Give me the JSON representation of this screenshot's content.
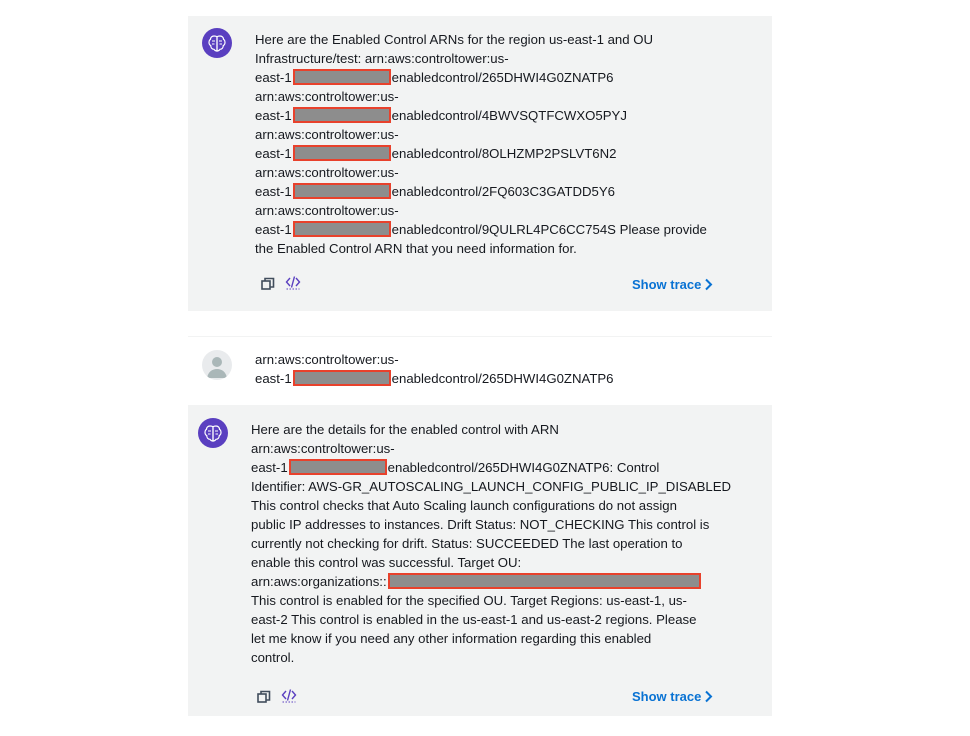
{
  "messages": [
    {
      "role": "assistant",
      "lines": [
        {
          "pre": "Here are the Enabled Control ARNs for the region us-east-1 and OU"
        },
        {
          "pre": "Infrastructure/test: arn:aws:controltower:us-"
        },
        {
          "pre": "east-1",
          "redacted": true,
          "post": "enabledcontrol/265DHWI4G0ZNATP6"
        },
        {
          "pre": "arn:aws:controltower:us-"
        },
        {
          "pre": "east-1",
          "redacted": true,
          "post": "enabledcontrol/4BWVSQTFCWXO5PYJ"
        },
        {
          "pre": "arn:aws:controltower:us-"
        },
        {
          "pre": "east-1",
          "redacted": true,
          "post": "enabledcontrol/8OLHZMP2PSLVT6N2"
        },
        {
          "pre": "arn:aws:controltower:us-"
        },
        {
          "pre": "east-1",
          "redacted": true,
          "post": "enabledcontrol/2FQ603C3GATDD5Y6"
        },
        {
          "pre": "arn:aws:controltower:us-"
        },
        {
          "pre": "east-1",
          "redacted": true,
          "post": "enabledcontrol/9QULRL4PC6CC754S Please provide"
        },
        {
          "pre": "the Enabled Control ARN that you need information for."
        }
      ],
      "show_trace": "Show trace"
    },
    {
      "role": "user",
      "lines": [
        {
          "pre": "arn:aws:controltower:us-"
        },
        {
          "pre": "east-1",
          "redacted": true,
          "post": "enabledcontrol/265DHWI4G0ZNATP6"
        }
      ]
    },
    {
      "role": "assistant",
      "lines": [
        {
          "pre": "Here are the details for the enabled control with ARN"
        },
        {
          "pre": "arn:aws:controltower:us-"
        },
        {
          "pre": "east-1",
          "redacted": true,
          "post": "enabledcontrol/265DHWI4G0ZNATP6: Control"
        },
        {
          "pre": "Identifier: AWS-GR_AUTOSCALING_LAUNCH_CONFIG_PUBLIC_IP_DISABLED"
        },
        {
          "pre": "This control checks that Auto Scaling launch configurations do not assign"
        },
        {
          "pre": "public IP addresses to instances. Drift Status: NOT_CHECKING This control is"
        },
        {
          "pre": "currently not checking for drift. Status: SUCCEEDED The last operation to"
        },
        {
          "pre": "enable this control was successful. Target OU:"
        },
        {
          "pre": "arn:aws:organizations::",
          "redacted": true,
          "wide": true,
          "post": ""
        },
        {
          "pre": "This control is enabled for the specified OU. Target Regions: us-east-1, us-"
        },
        {
          "pre": "east-2 This control is enabled in the us-east-1 and us-east-2 regions. Please"
        },
        {
          "pre": "let me know if you need any other information regarding this enabled"
        },
        {
          "pre": "control."
        }
      ],
      "show_trace": "Show trace"
    }
  ],
  "colors": {
    "accent": "#0972d3",
    "redaction_border": "#e8412c",
    "bot_avatar": "#5a3fc0"
  },
  "icons": [
    "brain-icon",
    "user-icon",
    "copy-icon",
    "code-icon",
    "chevron-right-icon"
  ]
}
